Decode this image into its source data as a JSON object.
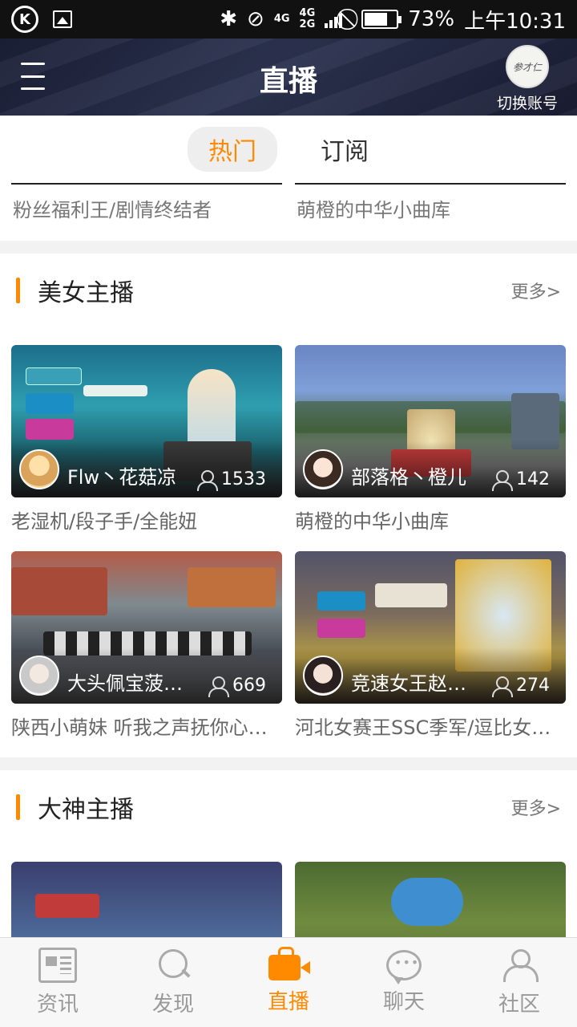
{
  "status_bar": {
    "network": "4G",
    "network2": "4G",
    "network3": "2G",
    "battery": "73%",
    "time": "上午10:31"
  },
  "header": {
    "title": "直播",
    "account_label": "切换账号",
    "account_avatar_text": "参才仁"
  },
  "tabs": [
    {
      "label": "热门",
      "active": true
    },
    {
      "label": "订阅",
      "active": false
    }
  ],
  "peek": [
    "粉丝福利王/剧情终结者",
    "萌橙的中华小曲库"
  ],
  "sections": [
    {
      "title": "美女主播",
      "more": "更多>",
      "cards": [
        {
          "anchor": "Flw丶花菇凉",
          "viewers": "1533",
          "desc": "老湿机/段子手/全能妞"
        },
        {
          "anchor": "部落格丶橙儿",
          "viewers": "142",
          "desc": "萌橙的中华小曲库"
        },
        {
          "anchor": "大头佩宝菠…",
          "viewers": "669",
          "desc": "陕西小萌妹 听我之声抚你心…"
        },
        {
          "anchor": "竞速女王赵…",
          "viewers": "274",
          "desc": "河北女赛王SSC季军/逗比女…"
        }
      ]
    },
    {
      "title": "大神主播",
      "more": "更多>"
    }
  ],
  "bottom_nav": [
    {
      "label": "资讯",
      "icon": "news-icon",
      "active": false
    },
    {
      "label": "发现",
      "icon": "search-icon",
      "active": false
    },
    {
      "label": "直播",
      "icon": "live-camera-icon",
      "active": true
    },
    {
      "label": "聊天",
      "icon": "chat-icon",
      "active": false
    },
    {
      "label": "社区",
      "icon": "community-icon",
      "active": false
    }
  ],
  "colors": {
    "accent": "#ff8a00",
    "header_bg": "#1f2440"
  }
}
